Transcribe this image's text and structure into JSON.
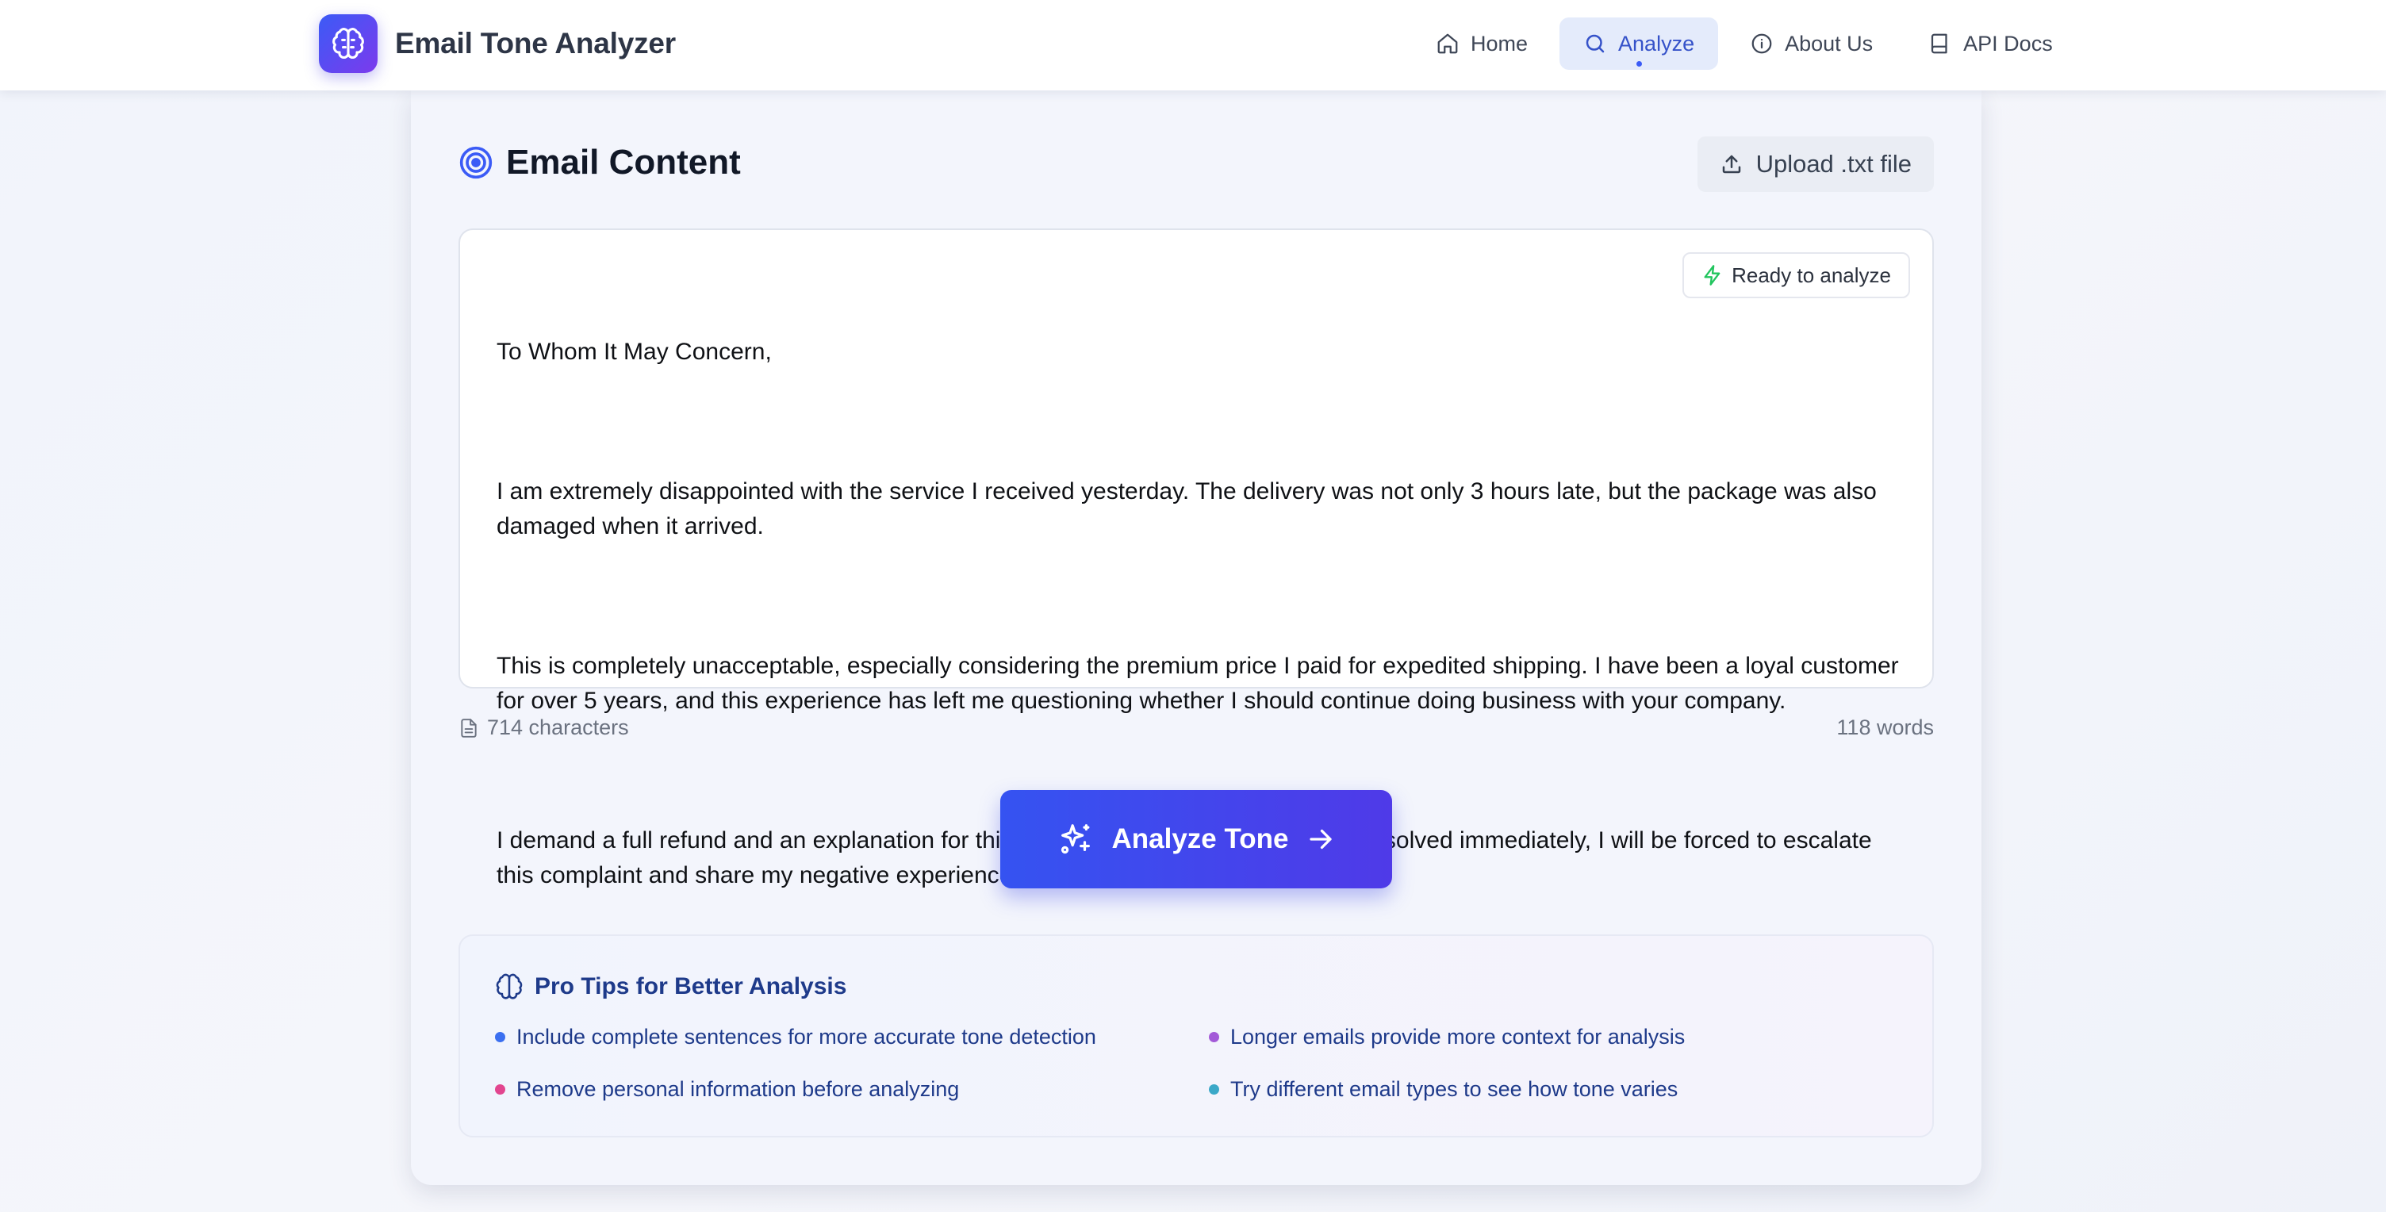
{
  "app": {
    "title": "Email Tone Analyzer"
  },
  "nav": {
    "items": [
      {
        "label": "Home",
        "icon": "home-icon"
      },
      {
        "label": "Analyze",
        "icon": "search-icon",
        "active": true
      },
      {
        "label": "About Us",
        "icon": "info-icon"
      },
      {
        "label": "API Docs",
        "icon": "book-icon"
      }
    ]
  },
  "editor_section": {
    "title": "Email Content",
    "upload_label": "Upload .txt file",
    "status_badge": "Ready to analyze",
    "paragraphs": [
      "To Whom It May Concern,",
      "I am extremely disappointed with the service I received yesterday. The delivery was not only 3 hours late, but the package was also damaged when it arrived.",
      "This is completely unacceptable, especially considering the premium price I paid for expedited shipping. I have been a loyal customer for over 5 years, and this experience has left me questioning whether I should continue doing business with your company.",
      "I demand a full refund and an explanation for this poor service. If this matter is not resolved immediately, I will be forced to escalate this complaint and share my negative experience on social media."
    ],
    "char_count": "714 characters",
    "word_count": "118 words"
  },
  "analyze_button": {
    "label": "Analyze Tone"
  },
  "tips": {
    "title": "Pro Tips for Better Analysis",
    "items": [
      {
        "text": "Include complete sentences for more accurate tone detection",
        "color": "#3b6ff0"
      },
      {
        "text": "Longer emails provide more context for analysis",
        "color": "#a35ad8"
      },
      {
        "text": "Remove personal information before analyzing",
        "color": "#e2458f"
      },
      {
        "text": "Try different email types to see how tone varies",
        "color": "#3aa8c8"
      }
    ]
  },
  "colors": {
    "accent": "#3b5bf6",
    "accent_purple": "#4f3ae8",
    "ready_icon": "#22c55e",
    "tips_text": "#1e3a8a"
  }
}
